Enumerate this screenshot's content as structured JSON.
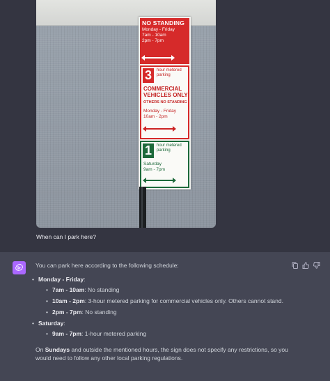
{
  "user_message": {
    "text": "When can I park here?",
    "image": {
      "sign_panels": [
        {
          "title": "NO STANDING",
          "lines": [
            "Monday - Friday",
            "7am - 10am",
            "2pm - 7pm"
          ]
        },
        {
          "number": "3",
          "number_caption": "hour metered parking",
          "title": "COMMERCIAL VEHICLES ONLY",
          "subtitle": "OTHERS NO STANDING",
          "lines": [
            "Monday - Friday",
            "10am - 2pm"
          ]
        },
        {
          "number": "1",
          "number_caption": "hour metered parking",
          "lines": [
            "Saturday",
            "9am - 7pm"
          ]
        }
      ]
    }
  },
  "assistant_message": {
    "intro": "You can park here according to the following schedule:",
    "schedule": [
      {
        "day": "Monday - Friday",
        "day_suffix": ":",
        "items": [
          {
            "time": "7am - 10am",
            "desc": ": No standing"
          },
          {
            "time": "10am - 2pm",
            "desc": ": 3-hour metered parking for commercial vehicles only. Others cannot stand."
          },
          {
            "time": "2pm - 7pm",
            "desc": ": No standing"
          }
        ]
      },
      {
        "day": "Saturday",
        "day_suffix": ":",
        "items": [
          {
            "time": "9am - 7pm",
            "desc": ": 1-hour metered parking"
          }
        ]
      }
    ],
    "outro_prefix": "On ",
    "outro_bold": "Sundays",
    "outro_rest": " and outside the mentioned hours, the sign does not specify any restrictions, so you would need to follow any other local parking regulations."
  },
  "actions": [
    "copy-icon",
    "thumbs-up-icon",
    "thumbs-down-icon"
  ],
  "colors": {
    "background": "#343541",
    "assistant_bg": "#444654",
    "avatar": "#ab68ff",
    "scroll_indicator": "#5b63d6"
  }
}
